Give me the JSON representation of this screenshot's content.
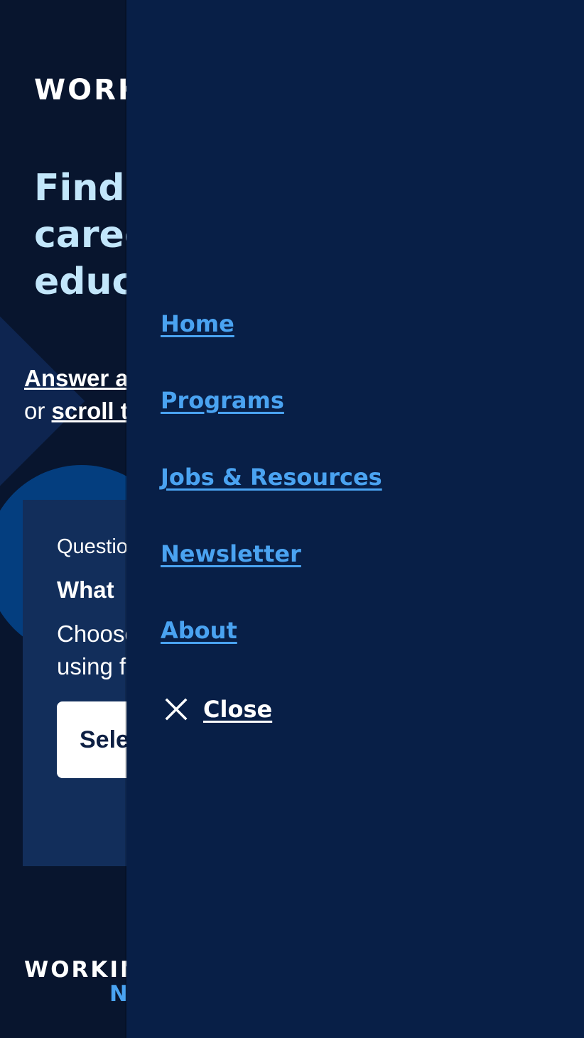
{
  "background": {
    "logo": "WORKING",
    "hero": [
      "Find a",
      "career in",
      "education"
    ],
    "intro": {
      "answer_link": "Answer a",
      "or_text": "or ",
      "scroll_link": "scroll t"
    },
    "question": {
      "number": "Question",
      "title": "What",
      "description": [
        "Choose",
        "using f"
      ],
      "select_label": "Select"
    },
    "footer_logo": {
      "line1": "WORKING",
      "line2": "N"
    }
  },
  "nav": {
    "items": [
      {
        "label": "Home"
      },
      {
        "label": "Programs"
      },
      {
        "label": "Jobs & Resources"
      },
      {
        "label": "Newsletter"
      },
      {
        "label": "About"
      }
    ],
    "close_label": "Close",
    "close_icon": "close-icon"
  },
  "colors": {
    "page_bg": "#08152e",
    "drawer_bg": "#081f47",
    "link": "#4aa3f1",
    "hero_text": "#c2e6fb",
    "card_bg": "#122e5b",
    "white": "#ffffff"
  }
}
